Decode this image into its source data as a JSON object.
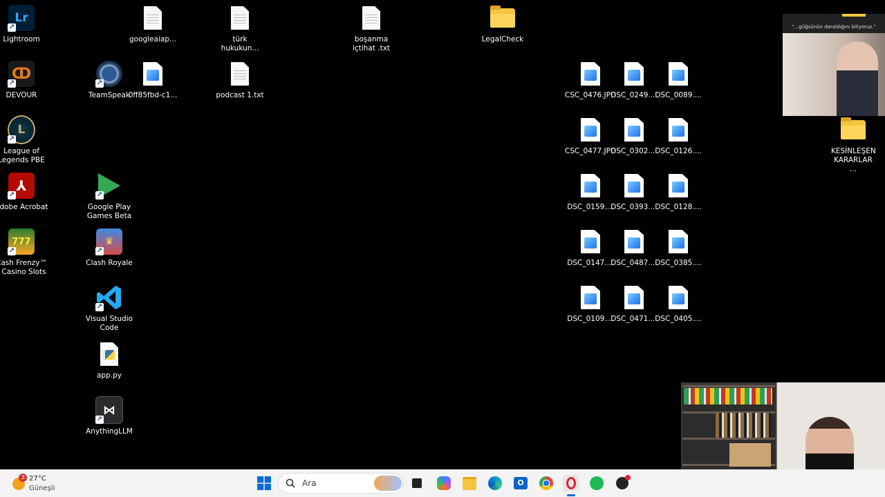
{
  "desktop": {
    "icons": [
      {
        "id": "lightroom",
        "label": "Lightroom",
        "glyph": "Lr",
        "kind": "app"
      },
      {
        "id": "devour",
        "label": "DEVOUR",
        "glyph": "d",
        "kind": "app"
      },
      {
        "id": "lol-pbe",
        "label": "League of Legends PBE",
        "glyph": "L",
        "kind": "app"
      },
      {
        "id": "acrobat",
        "label": "Adobe Acrobat",
        "glyph": "A",
        "kind": "app"
      },
      {
        "id": "cash-frenzy",
        "label": "Cash Frenzy™ - Casino Slots",
        "glyph": "777",
        "kind": "app"
      },
      {
        "id": "teamspeak",
        "label": "TeamSpeak",
        "glyph": "TS",
        "kind": "app"
      },
      {
        "id": "gplay-games",
        "label": "Google Play Games Beta",
        "glyph": "▶",
        "kind": "app"
      },
      {
        "id": "clash-royale",
        "label": "Clash Royale",
        "glyph": "CR",
        "kind": "app"
      },
      {
        "id": "vscode",
        "label": "Visual Studio Code",
        "glyph": "⟩",
        "kind": "app"
      },
      {
        "id": "app-py",
        "label": "app.py",
        "glyph": "py",
        "kind": "file"
      },
      {
        "id": "anythingllm",
        "label": "AnythingLLM",
        "glyph": "⋈",
        "kind": "app"
      },
      {
        "id": "googleaiap",
        "label": "googleaiap...",
        "kind": "doc"
      },
      {
        "id": "0ff85fbd",
        "label": "0ff85fbd-c1...",
        "kind": "img"
      },
      {
        "id": "turk-hukuku",
        "label": "türk hukukun...",
        "kind": "doc"
      },
      {
        "id": "podcast",
        "label": "podcast 1.txt",
        "kind": "doc"
      },
      {
        "id": "bosanma",
        "label": "boşanma içtihat .txt",
        "kind": "doc"
      },
      {
        "id": "legalcheck",
        "label": "LegalCheck",
        "kind": "folder"
      },
      {
        "id": "kesinlesen",
        "label": "KESİNLEŞEN KARARLAR ...",
        "kind": "folder"
      }
    ],
    "photos": [
      [
        "CSC_0476.JPG",
        "DSC_0249....",
        "DSC_0089...."
      ],
      [
        "CSC_0477.JPG",
        "DSC_0302....",
        "DSC_0126...."
      ],
      [
        "DSC_0159....",
        "DSC_0393....",
        "DSC_0128...."
      ],
      [
        "DSC_0147....",
        "DSC_0487....",
        "DSC_0385...."
      ],
      [
        "DSC_0109....",
        "DSC_0471....",
        "DSC_0405...."
      ]
    ]
  },
  "overlay": {
    "caption": "\"...güğsünün daraldığını biliyoruz.\""
  },
  "taskbar": {
    "weather": {
      "badge": "3",
      "temp": "27°C",
      "condition": "Güneşli"
    },
    "search_placeholder": "Ara",
    "apps": [
      "start-icon",
      "search-icon",
      "task-view-icon",
      "copilot-icon",
      "file-explorer-icon",
      "edge-icon",
      "outlook-icon",
      "chrome-icon",
      "opera-icon",
      "spotify-icon",
      "app-icon"
    ]
  },
  "colors": {
    "desktop": "#000000",
    "taskbar": "#f3f3f3",
    "folder": "#f5c542",
    "accent": "#1a73e8"
  }
}
